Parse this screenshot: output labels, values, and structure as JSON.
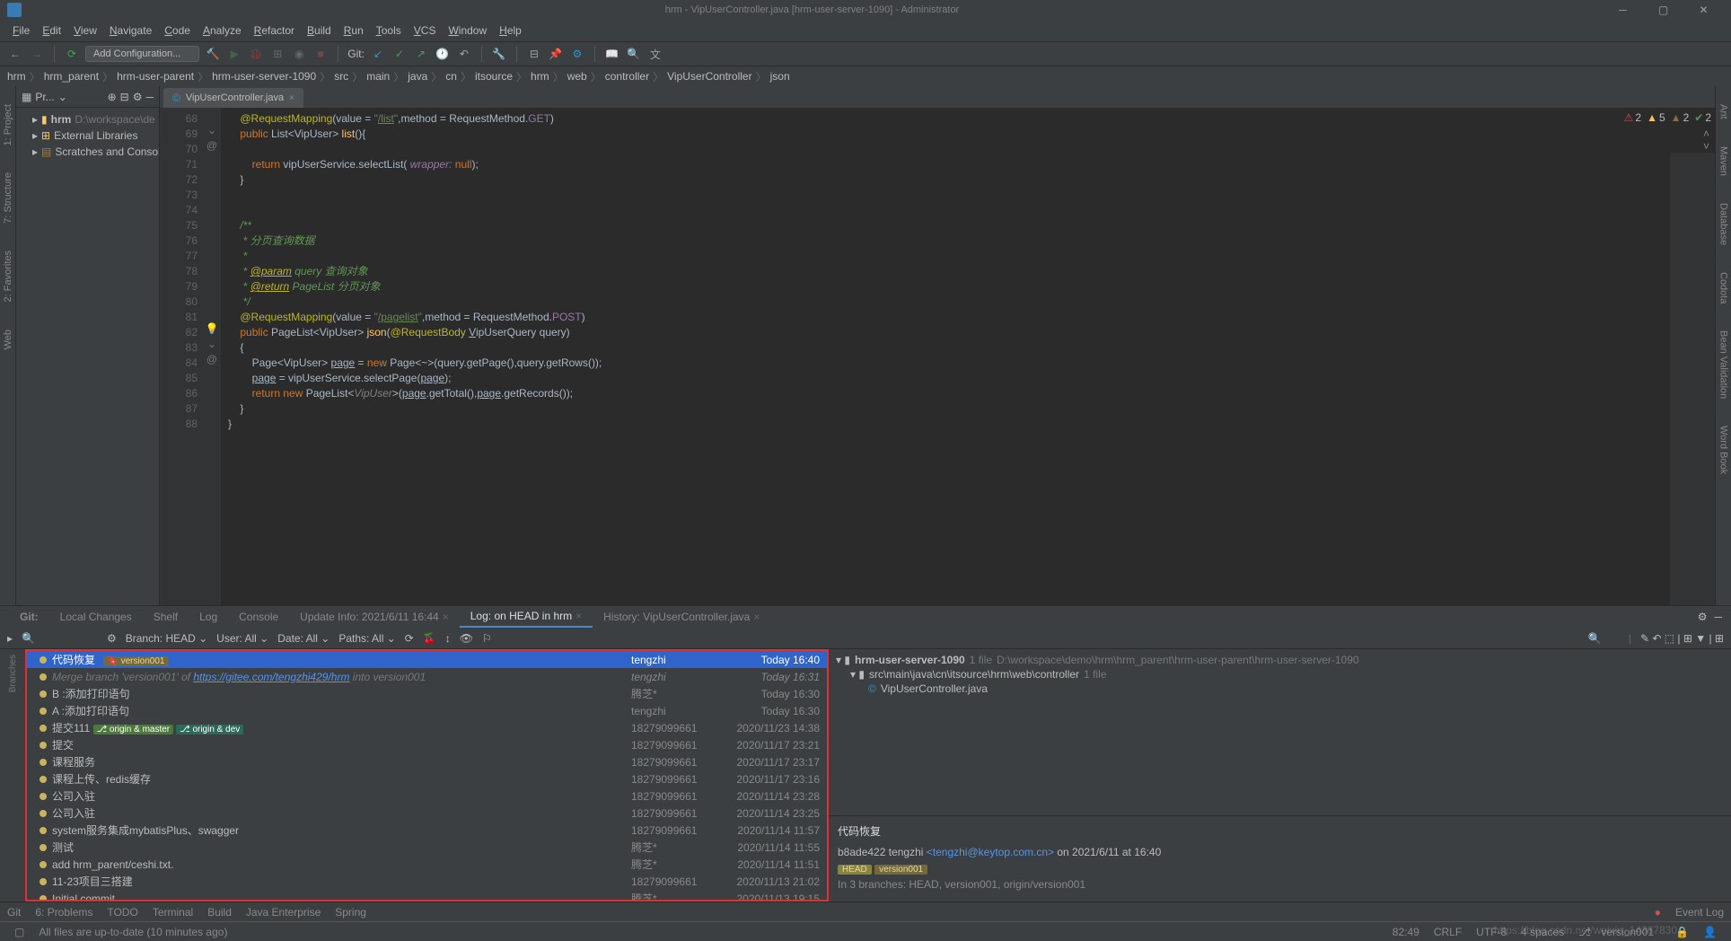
{
  "title": "hrm - VipUserController.java [hrm-user-server-1090] - Administrator",
  "menu": [
    "File",
    "Edit",
    "View",
    "Navigate",
    "Code",
    "Analyze",
    "Refactor",
    "Build",
    "Run",
    "Tools",
    "VCS",
    "Window",
    "Help"
  ],
  "add_config": "Add Configuration...",
  "git_label": "Git:",
  "breadcrumbs": [
    "hrm",
    "hrm_parent",
    "hrm-user-parent",
    "hrm-user-server-1090",
    "src",
    "main",
    "java",
    "cn",
    "itsource",
    "hrm",
    "web",
    "controller",
    "VipUserController",
    "json"
  ],
  "proj_header": "Pr...",
  "project": {
    "root": "hrm",
    "root_path": "D:\\workspace\\de",
    "ext_lib": "External Libraries",
    "scratches": "Scratches and Console"
  },
  "tabs": [
    {
      "label": "VipUserController.java",
      "active": true
    }
  ],
  "lines": [
    {
      "n": 68,
      "html": "    <span class='a'>@RequestMapping</span>(value = <span class='s'>\"<span class='u'>/list</span>\"</span>,method = RequestMethod.<span class='m'>GET</span>)"
    },
    {
      "n": 69,
      "marks": "⌄ @",
      "html": "    <span class='k'>public</span> List&lt;VipUser&gt; <span class='t'>list</span>(){"
    },
    {
      "n": 70,
      "html": ""
    },
    {
      "n": 71,
      "html": "        <span class='k'>return</span> vipUserService.selectList( <span class='p'>wrapper:</span> <span class='k'>null</span>);"
    },
    {
      "n": 72,
      "html": "    }"
    },
    {
      "n": 73,
      "html": ""
    },
    {
      "n": 74,
      "html": ""
    },
    {
      "n": 75,
      "html": "    <span class='d'>/**</span>"
    },
    {
      "n": 76,
      "html": "    <span class='d'> * 分页查询数据</span>"
    },
    {
      "n": 77,
      "html": "    <span class='d'> *</span>"
    },
    {
      "n": 78,
      "html": "    <span class='d'> * <span class='a u'>@param</span> query 查询对象</span>"
    },
    {
      "n": 79,
      "html": "    <span class='d'> * <span class='a u'>@return</span> PageList 分页对象</span>"
    },
    {
      "n": 80,
      "html": "    <span class='d'> */</span>"
    },
    {
      "n": 81,
      "html": "    <span class='a'>@RequestMapping</span>(value = <span class='s'>\"<span class='u'>/pagelist</span>\"</span>,method = RequestMethod.<span class='m'>POST</span>)"
    },
    {
      "n": 82,
      "marks": "⌄ @",
      "bulb": true,
      "html": "    <span class='k'>public</span> PageList&lt;VipUser&gt; <span class='t'>json</span>(<span class='a'>@RequestBody</span> <span class='u'>V</span>ipUserQuery query)"
    },
    {
      "n": 83,
      "html": "    {"
    },
    {
      "n": 84,
      "html": "        Page&lt;VipUser&gt; <span class='u'>page</span> = <span class='k'>new</span> Page&lt;~&gt;(query.getPage(),query.getRows());"
    },
    {
      "n": 85,
      "html": "        <span class='u'>page</span> = vipUserService.selectPage(<span class='u'>page</span>);"
    },
    {
      "n": 86,
      "html": "        <span class='k'>return new</span> PageList&lt;<span class='c'>VipUser</span>&gt;(<span class='u'>page</span>.getTotal(),<span class='u'>page</span>.getRecords());"
    },
    {
      "n": 87,
      "html": "    }"
    },
    {
      "n": 88,
      "html": "}"
    }
  ],
  "warnings": [
    {
      "icon": "⚠",
      "col": "#c75450",
      "n": "2"
    },
    {
      "icon": "▲",
      "col": "#f2c55c",
      "n": "5"
    },
    {
      "icon": "▲",
      "col": "#857042",
      "n": "2"
    },
    {
      "icon": "✔",
      "col": "#499c54",
      "n": "2"
    }
  ],
  "vcs_tabs": [
    {
      "label": "Git:",
      "bold": true
    },
    {
      "label": "Local Changes"
    },
    {
      "label": "Shelf"
    },
    {
      "label": "Log"
    },
    {
      "label": "Console"
    },
    {
      "label": "Update Info: 2021/6/11 16:44",
      "close": true
    },
    {
      "label": "Log: on HEAD in hrm",
      "active": true,
      "close": true
    },
    {
      "label": "History: VipUserController.java",
      "close": true
    }
  ],
  "vcs_filter": {
    "branch": "Branch: HEAD ⌄",
    "user": "User: All ⌄",
    "date": "Date: All ⌄",
    "paths": "Paths: All ⌄"
  },
  "commits": [
    {
      "msg": "代码恢复",
      "tag": "version001",
      "auth": "tengzhi",
      "date": "Today 16:40",
      "sel": true
    },
    {
      "msg": "Merge branch 'version001' of <a>https://gitee.com/tengzhi429/hrm</a> into version001",
      "auth": "tengzhi",
      "date": "Today 16:31",
      "merge": true
    },
    {
      "msg": "B :添加打印语句",
      "auth": "腾芝*",
      "date": "Today 16:30"
    },
    {
      "msg": "A :添加打印语句",
      "auth": "tengzhi",
      "date": "Today 16:30"
    },
    {
      "msg": "提交111",
      "branches": [
        {
          "t": "origin & master",
          "c": "#4a7a3a"
        },
        {
          "t": "origin & dev",
          "c": "#2a6a5a"
        }
      ],
      "auth": "18279099661",
      "date": "2020/11/23 14:38"
    },
    {
      "msg": "提交",
      "auth": "18279099661",
      "date": "2020/11/17 23:21"
    },
    {
      "msg": "课程服务",
      "auth": "18279099661",
      "date": "2020/11/17 23:17"
    },
    {
      "msg": "课程上传、redis缓存",
      "auth": "18279099661",
      "date": "2020/11/17 23:16"
    },
    {
      "msg": "公司入驻",
      "auth": "18279099661",
      "date": "2020/11/14 23:28"
    },
    {
      "msg": "公司入驻",
      "auth": "18279099661",
      "date": "2020/11/14 23:25"
    },
    {
      "msg": "system服务集成mybatisPlus、swagger",
      "auth": "18279099661",
      "date": "2020/11/14 11:57"
    },
    {
      "msg": "测试",
      "auth": "腾芝*",
      "date": "2020/11/14 11:55"
    },
    {
      "msg": "add hrm_parent/ceshi.txt.",
      "auth": "腾芝*",
      "date": "2020/11/14 11:51"
    },
    {
      "msg": "11-23项目三搭建",
      "auth": "18279099661",
      "date": "2020/11/13 21:02"
    },
    {
      "msg": "Initial commit",
      "auth": "腾芝*",
      "date": "2020/11/13 19:15"
    }
  ],
  "details": {
    "root": "hrm-user-server-1090",
    "root_cnt": "1 file",
    "root_path": "D:\\workspace\\demo\\hrm\\hrm_parent\\hrm-user-parent\\hrm-user-server-1090",
    "pkg": "src\\main\\java\\cn\\itsource\\hrm\\web\\controller",
    "pkg_cnt": "1 file",
    "file": "VipUserController.java",
    "title": "代码恢复",
    "hash": "b8ade422 tengzhi",
    "email": "<tengzhi@keytop.com.cn>",
    "when": "on 2021/6/11 at 16:40",
    "head": "HEAD",
    "tag": "version001",
    "branches_line": "In 3 branches: HEAD, version001, origin/version001"
  },
  "bottom": [
    "Git",
    "6: Problems",
    "TODO",
    "Terminal",
    "Build",
    "Java Enterprise",
    "Spring"
  ],
  "event_log": "Event Log",
  "status": {
    "msg": "All files are up-to-date (10 minutes ago)",
    "pos": "82:49",
    "eol": "CRLF",
    "enc": "UTF-8",
    "sp": "4 spaces",
    "branch": "version001"
  },
  "left_tabs": [
    "1: Project",
    "7: Structure",
    "2: Favorites",
    "Web"
  ],
  "right_tabs": [
    "Ant",
    "Maven",
    "Database",
    "Codota",
    "Bean Validation",
    "Word Book"
  ],
  "watermark": "https://blog.csdn.net/weixin_14367830"
}
